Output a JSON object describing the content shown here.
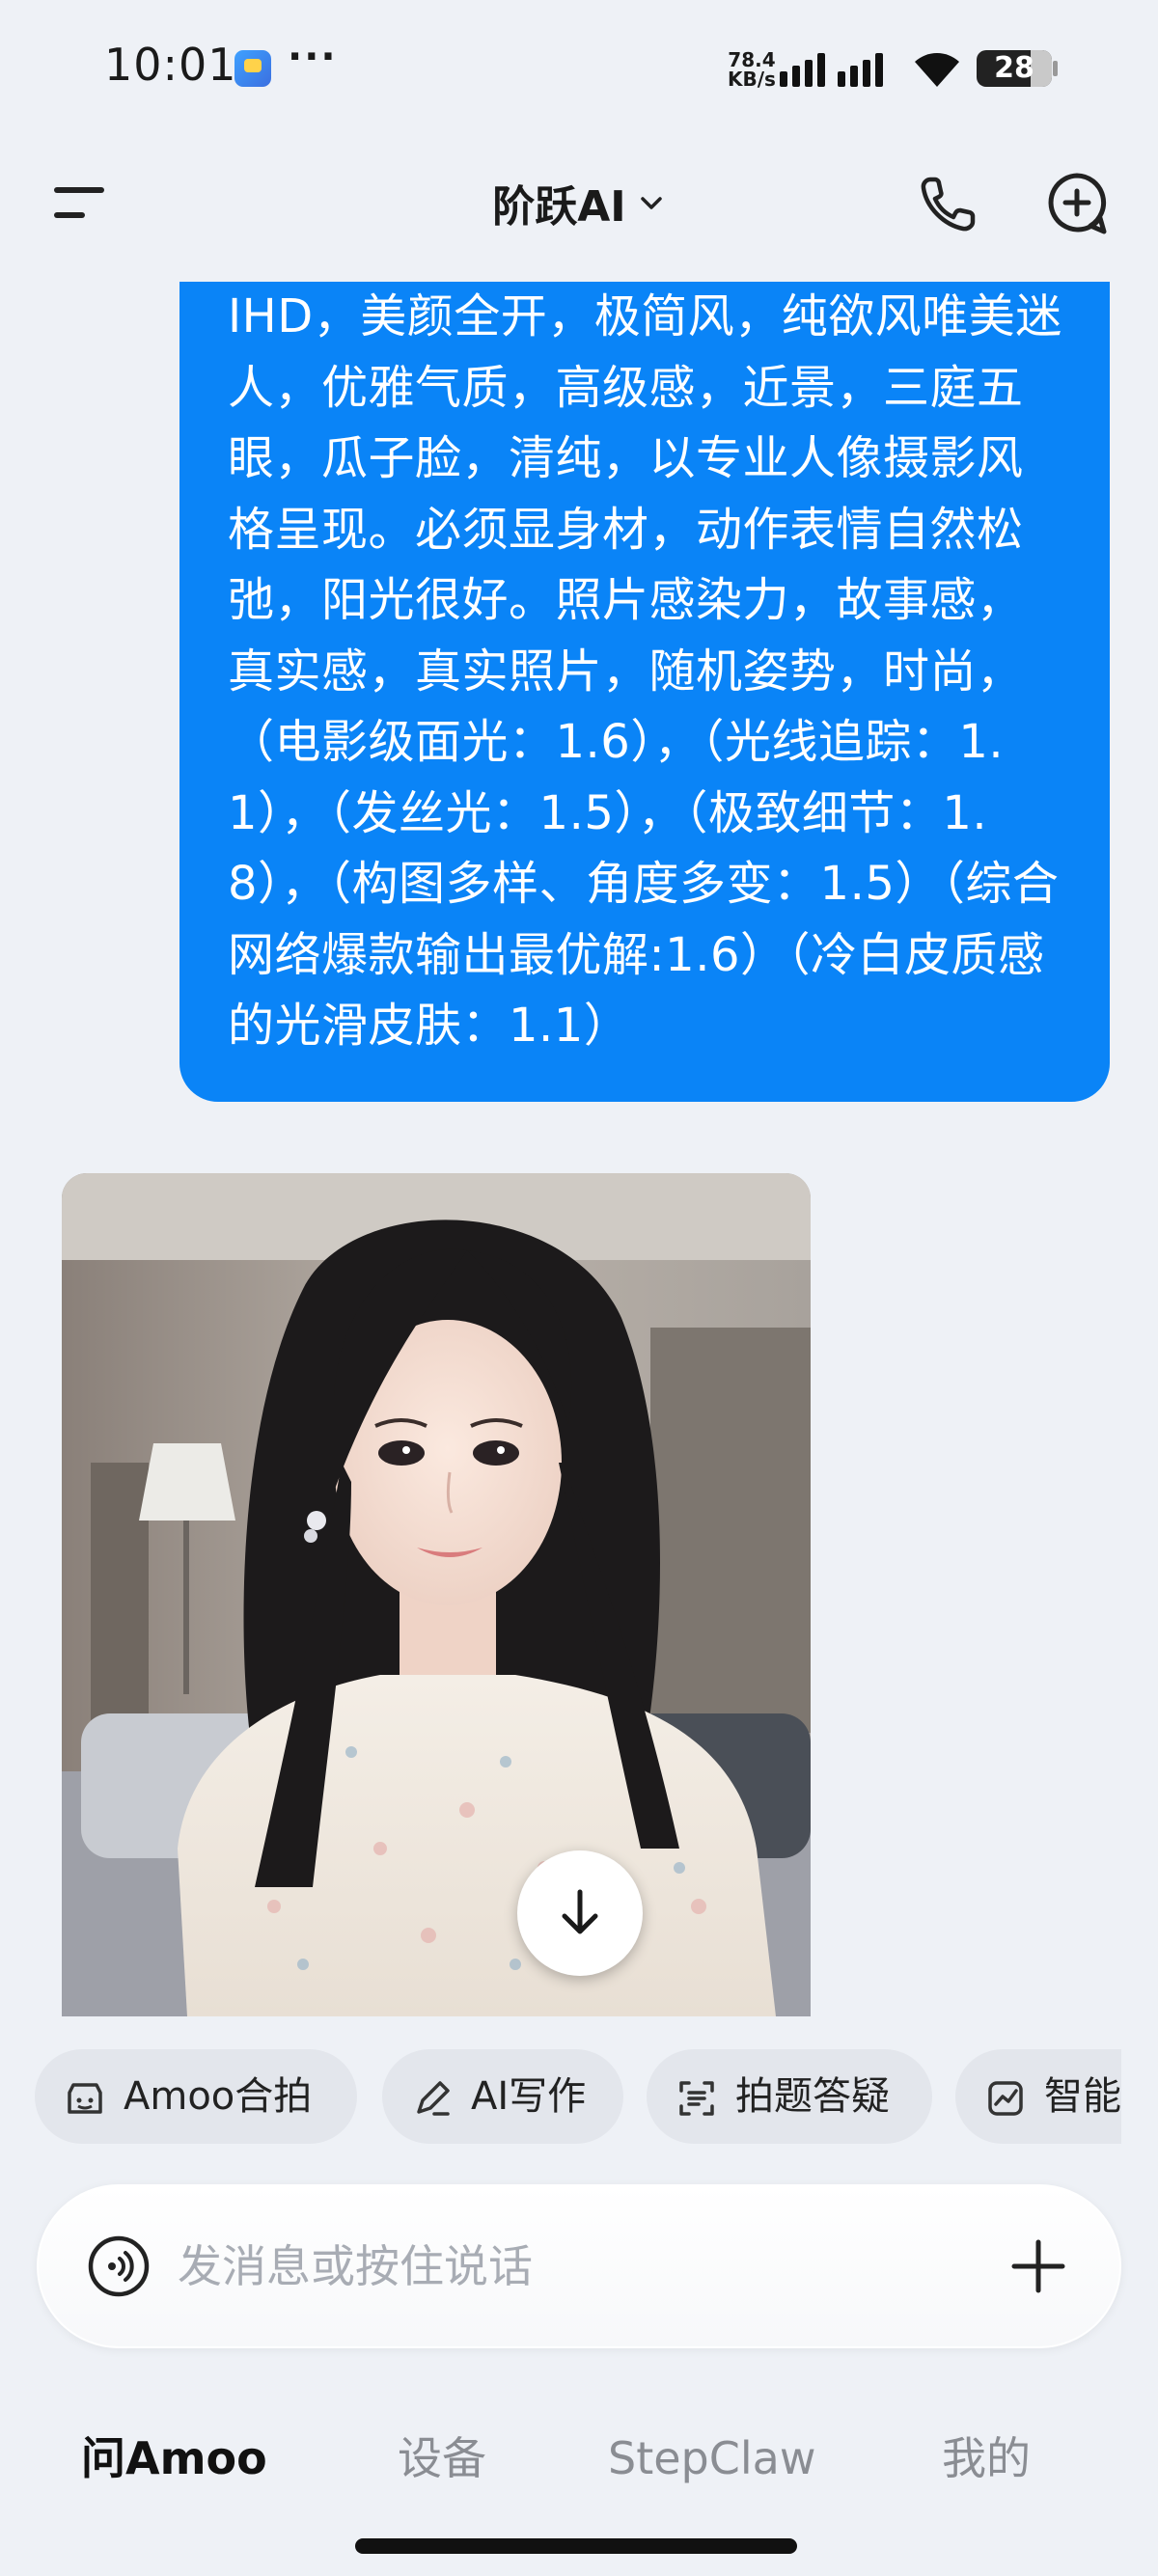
{
  "status_bar": {
    "time": "10:01",
    "more": "···",
    "net_speed_value": "78.4",
    "net_speed_unit": "KB/s",
    "battery": "28",
    "battery_level": 0.28
  },
  "header": {
    "title": "阶跃AI",
    "icons": [
      "menu-icon",
      "chevron-down-icon",
      "phone-icon",
      "new-chat-icon"
    ]
  },
  "message": {
    "text": "IHD，美颜全开，极简风，纯欲风唯美迷人，优雅气质，高级感，近景，三庭五眼，瓜子脸，清纯，以专业人像摄影风格呈现。必须显身材，动作表情自然松弛，阳光很好。照片感染力，故事感，真实感，真实照片，随机姿势，时尚，（电影级面光：1.6），（光线追踪：1.1），（发丝光：1.5），（极致细节：1.8），（构图多样、角度多变：1.5）（综合网络爆款输出最优解:1.6）（冷白皮质感的光滑皮肤：1.1）",
    "bubble_color": "#0a84f7"
  },
  "chips": [
    {
      "label": "Amoo合拍",
      "icon": "amoo-icon"
    },
    {
      "label": "AI写作",
      "icon": "pen-icon"
    },
    {
      "label": "拍题答疑",
      "icon": "scan-icon"
    },
    {
      "label": "智能",
      "icon": "chart-icon"
    }
  ],
  "input": {
    "placeholder": "发消息或按住说话"
  },
  "bottom_nav": [
    {
      "label": "问Amoo",
      "active": true
    },
    {
      "label": "设备",
      "active": false
    },
    {
      "label": "StepClaw",
      "active": false
    },
    {
      "label": "我的",
      "active": false
    }
  ],
  "colors": {
    "background": "#eef1f6",
    "accent": "#0a84f7"
  }
}
